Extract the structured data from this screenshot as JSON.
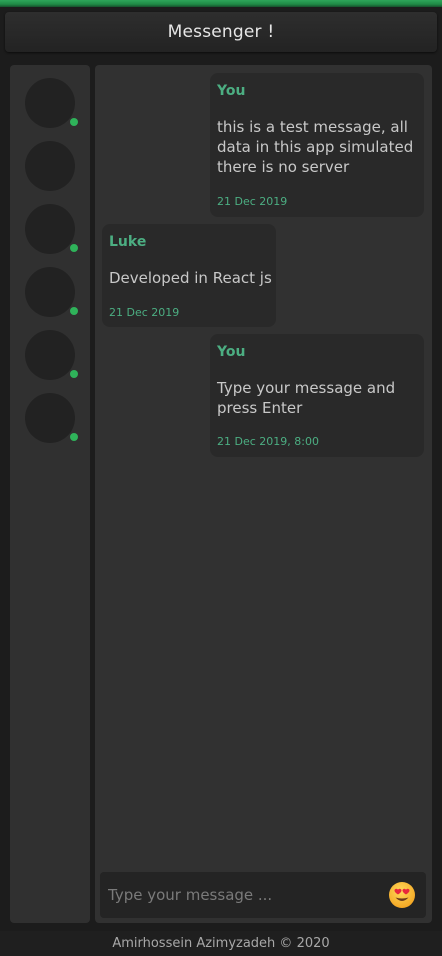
{
  "app": {
    "title": "Messenger !"
  },
  "sidebar": {
    "contacts": [
      {
        "icon": "avatar",
        "online": true
      },
      {
        "icon": "avatar",
        "online": false
      },
      {
        "icon": "avatar",
        "online": true
      },
      {
        "icon": "avatar",
        "online": true
      },
      {
        "icon": "avatar",
        "online": true
      },
      {
        "icon": "avatar",
        "online": true
      }
    ]
  },
  "messages": [
    {
      "author": "You",
      "text_lines": [
        "this is a test message, all",
        "data in this app simulated",
        "there is no server"
      ],
      "date": "21 Dec 2019",
      "side": "right"
    },
    {
      "author": "Luke",
      "text_lines": [
        "Developed in React js"
      ],
      "date": "21 Dec 2019",
      "side": "left"
    },
    {
      "author": "You",
      "text_lines": [
        "Type your message and",
        "press Enter"
      ],
      "date": "21 Dec 2019, 8:00",
      "side": "right"
    }
  ],
  "composer": {
    "placeholder": "Type your message ...",
    "emoji_icon": "heart-eyes-emoji-icon"
  },
  "footer": {
    "text": "Amirhossein Azimyzadeh © 2020"
  },
  "colors": {
    "accent": "#2fb35a",
    "author": "#4cae82",
    "panel": "#313131",
    "bubble": "#292929"
  }
}
